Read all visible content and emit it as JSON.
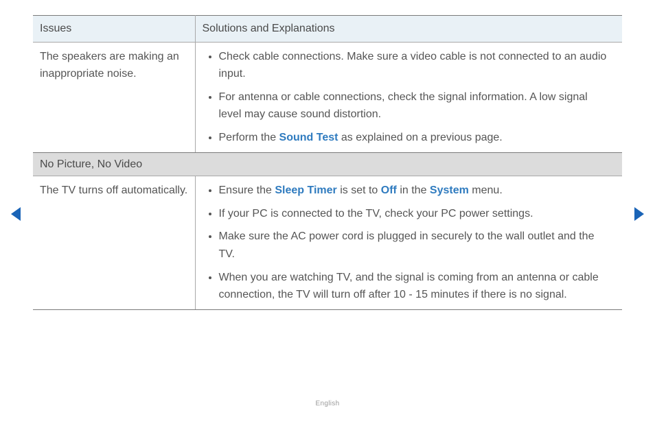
{
  "headers": {
    "issues": "Issues",
    "solutions": "Solutions and Explanations"
  },
  "row1": {
    "issue": "The speakers are making an inappropriate noise.",
    "bullets": {
      "b1": "Check cable connections. Make sure a video cable is not connected to an audio input.",
      "b2": "For antenna or cable connections, check the signal information. A low signal level may cause sound distortion.",
      "b3_pre": "Perform the ",
      "b3_hl": "Sound Test",
      "b3_post": " as explained on a previous page."
    }
  },
  "section2": {
    "title": "No Picture, No Video"
  },
  "row2": {
    "issue": "The TV turns off automatically.",
    "bullets": {
      "b1_pre": "Ensure the ",
      "b1_hl1": "Sleep Timer",
      "b1_mid1": " is set to ",
      "b1_hl2": "Off",
      "b1_mid2": " in the ",
      "b1_hl3": "System",
      "b1_post": " menu.",
      "b2": "If your PC is connected to the TV, check your PC power settings.",
      "b3": "Make sure the AC power cord is plugged in securely to the wall outlet and the TV.",
      "b4": "When you are watching TV, and the signal is coming from an antenna or cable connection, the TV will turn off after 10 - 15 minutes if there is no signal."
    }
  },
  "footer": {
    "language": "English"
  },
  "colors": {
    "link": "#2f7bbf",
    "arrow": "#1a64b7"
  }
}
